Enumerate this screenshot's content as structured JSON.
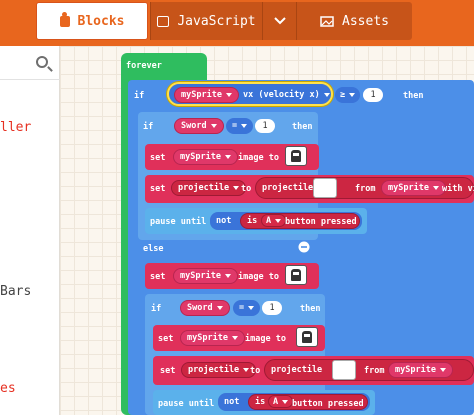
{
  "tabs": {
    "blocks": "Blocks",
    "javascript": "JavaScript",
    "assets": "Assets"
  },
  "toolbox": {
    "cat1": "ller",
    "cat2": "Bars",
    "cat3": "es"
  },
  "code": {
    "forever": "forever",
    "if_kw": "if",
    "then_kw": "then",
    "else_kw": "else",
    "set_kw": "set",
    "to_kw": "to",
    "image_to": "image to",
    "from_kw": "from",
    "with_vx": "with vx",
    "pause_until": "pause until",
    "not_kw": "not",
    "is_kw": "is",
    "button_pressed": "button pressed",
    "mySprite": "mySprite",
    "vx_prop": "vx (velocity x)",
    "geq": "≥",
    "eq": "=",
    "one": "1",
    "sword": "Sword",
    "projectile": "projectile",
    "a_btn": "A"
  },
  "colors": {
    "accent": "#e8661e",
    "loops": "#2fbd5f",
    "logic": "#4c8fe8",
    "sprites": "#e0305a",
    "controller": "#d62a48"
  }
}
